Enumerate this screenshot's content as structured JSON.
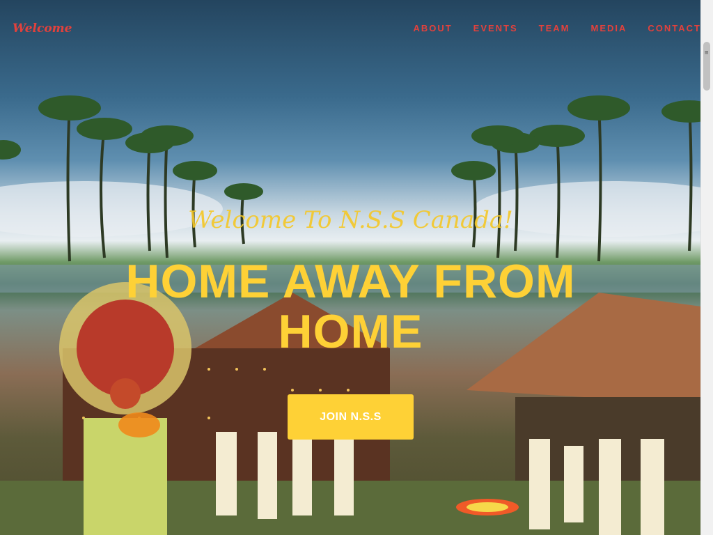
{
  "navbar": {
    "brand": "Welcome",
    "links": [
      {
        "label": "ABOUT"
      },
      {
        "label": "EVENTS"
      },
      {
        "label": "TEAM"
      },
      {
        "label": "MEDIA"
      },
      {
        "label": "CONTACT"
      }
    ]
  },
  "hero": {
    "subheading": "Welcome To N.S.S Canada!",
    "heading": "HOME AWAY FROM HOME",
    "cta_label": "JOIN N.S.S"
  },
  "colors": {
    "accent": "#fed136",
    "nav_link": "#e3413c"
  }
}
